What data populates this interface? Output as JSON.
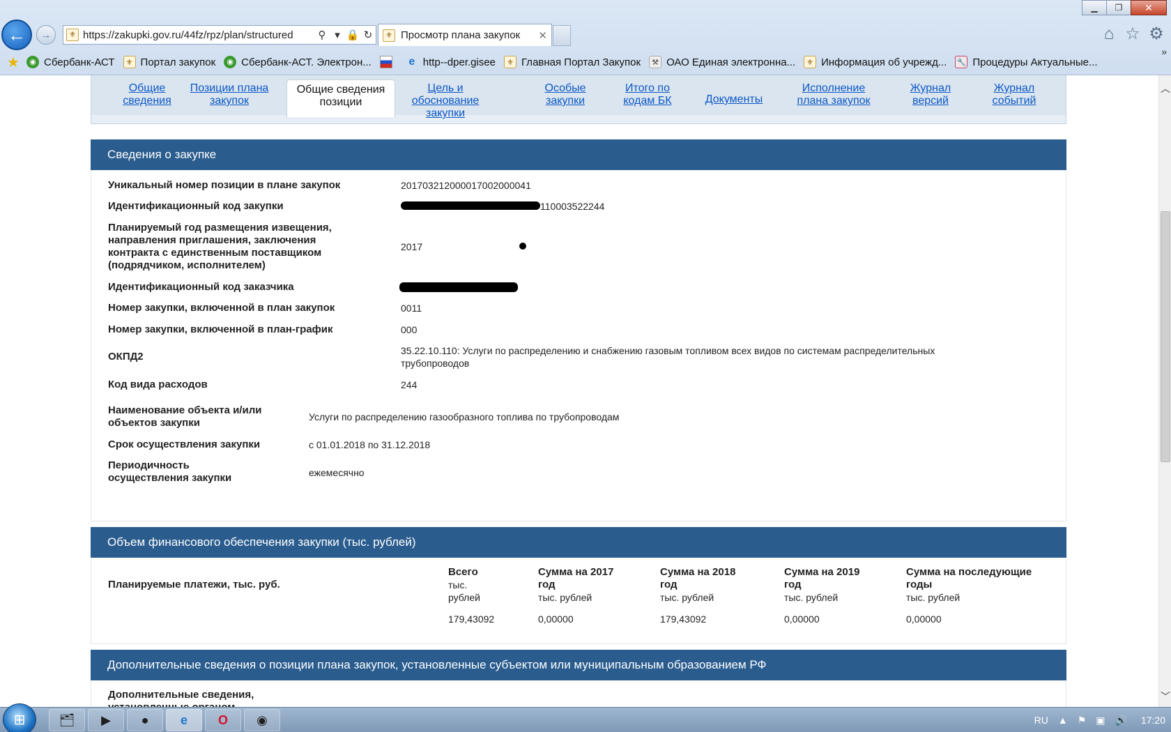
{
  "browser": {
    "url": "https://zakupki.gov.ru/44fz/rpz/plan/structured",
    "tab_title": "Просмотр плана закупок",
    "favorites": [
      {
        "label": "Сбербанк-АСТ",
        "icon": "green-circle-icon"
      },
      {
        "label": "Портал закупок",
        "icon": "eagle-icon"
      },
      {
        "label": "Сбербанк-АСТ. Электрон...",
        "icon": "green-circle-icon"
      },
      {
        "label": "",
        "icon": "flag-icon"
      },
      {
        "label": "http--dper.gisee",
        "icon": "ie-icon"
      },
      {
        "label": "Главная Портал Закупок",
        "icon": "eagle-icon"
      },
      {
        "label": "ОАО Единая электронна...",
        "icon": "gavel-icon"
      },
      {
        "label": "Информация об учрежд...",
        "icon": "eagle-icon"
      },
      {
        "label": "Процедуры  Актуальные...",
        "icon": "wrench-icon"
      }
    ]
  },
  "page_tabs": [
    {
      "label": "Общие сведения",
      "active": false
    },
    {
      "label": "Позиции плана закупок",
      "active": false
    },
    {
      "label": "Общие сведения позиции",
      "active": true
    },
    {
      "label": "Цель и обоснование закупки",
      "active": false
    },
    {
      "label": "Особые закупки",
      "active": false
    },
    {
      "label": "Итого по кодам БК",
      "active": false
    },
    {
      "label": "Документы",
      "active": false
    },
    {
      "label": "Исполнение плана закупок",
      "active": false
    },
    {
      "label": "Журнал версий",
      "active": false
    },
    {
      "label": "Журнал событий",
      "active": false
    }
  ],
  "purchase_info": {
    "header": "Сведения о закупке",
    "rows": [
      {
        "label": "Уникальный номер позиции в плане закупок",
        "value": "201703212000017002000041"
      },
      {
        "label": "Идентификационный код закупки",
        "value": "110003522244"
      },
      {
        "label": "Планируемый год размещения извещения, направления приглашения, заключения контракта с единственным поставщиком (подрядчиком, исполнителем)",
        "value": "2017"
      },
      {
        "label": "Идентификационный код заказчика",
        "value": ""
      },
      {
        "label": "Номер закупки, включенной в план закупок",
        "value": "0011"
      },
      {
        "label": "Номер закупки, включенной в план-график",
        "value": "000"
      },
      {
        "label": "ОКПД2",
        "value": "35.22.10.110: Услуги по распределению и снабжению газовым топливом всех видов по системам распределительных трубопроводов"
      },
      {
        "label": "Код вида расходов",
        "value": "244"
      },
      {
        "label": "Наименование объекта и/или объектов закупки",
        "value": "Услуги по распределению газообразного топлива по трубопроводам"
      },
      {
        "label": "Срок осуществления закупки",
        "value": "с 01.01.2018 по 31.12.2018"
      },
      {
        "label": "Периодичность осуществления закупки",
        "value": "ежемесячно"
      }
    ]
  },
  "finance": {
    "header": "Объем финансового обеспечения закупки (тыс. рублей)",
    "row_label": "Планируемые платежи, тыс. руб.",
    "columns": [
      {
        "title": "Всего",
        "unit": "тыс. рублей",
        "value": "179,43092"
      },
      {
        "title": "Сумма на 2017 год",
        "unit": "тыс. рублей",
        "value": "0,00000"
      },
      {
        "title": "Сумма на 2018 год",
        "unit": "тыс. рублей",
        "value": "179,43092"
      },
      {
        "title": "Сумма на 2019 год",
        "unit": "тыс. рублей",
        "value": "0,00000"
      },
      {
        "title": "Сумма на последующие годы",
        "unit": "тыс. рублей",
        "value": "0,00000"
      }
    ]
  },
  "additional": {
    "header": "Дополнительные сведения о позиции плана закупок, установленные субъектом или муниципальным образованием РФ",
    "row_label": "Дополнительные сведения, установленные органом"
  },
  "taskbar": {
    "lang": "RU",
    "clock": "17:20"
  }
}
